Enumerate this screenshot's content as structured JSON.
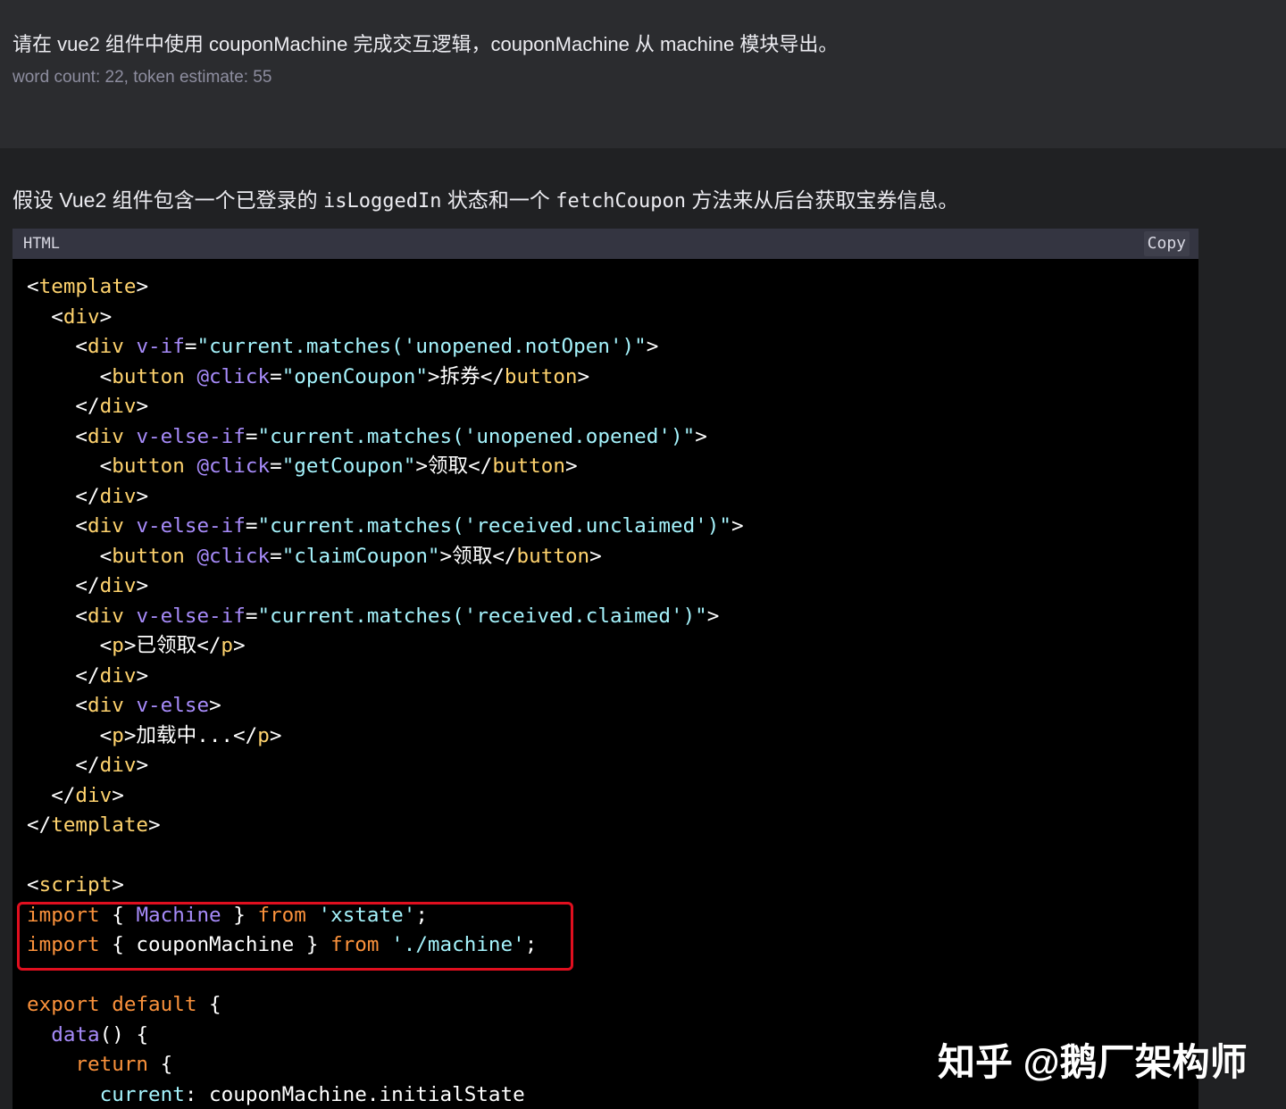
{
  "colors": {
    "tag": "#ffd36e",
    "attr": "#a78bfa",
    "string": "#a5f3fc",
    "keyword": "#fb923c",
    "plain": "#ffffff",
    "highlight": "#e00f1f"
  },
  "user_message": {
    "text": "请在 vue2 组件中使用 couponMachine 完成交互逻辑，couponMachine 从 machine 模块导出。",
    "meta": "word count: 22, token estimate: 55"
  },
  "assistant_message": {
    "intro_before": "假设 Vue2 组件包含一个已登录的 ",
    "code1": "isLoggedIn",
    "intro_mid": " 状态和一个 ",
    "code2": "fetchCoupon",
    "intro_after": " 方法来从后台获取宝券信息。"
  },
  "code_block": {
    "language": "HTML",
    "copy_label": "Copy",
    "lines": [
      [
        [
          "p",
          "<"
        ],
        [
          "t",
          "template"
        ],
        [
          "p",
          ">"
        ]
      ],
      [
        [
          "p",
          "  <"
        ],
        [
          "t",
          "div"
        ],
        [
          "p",
          ">"
        ]
      ],
      [
        [
          "p",
          "    <"
        ],
        [
          "t",
          "div"
        ],
        [
          "p",
          " "
        ],
        [
          "a",
          "v-if"
        ],
        [
          "p",
          "="
        ],
        [
          "s",
          "\"current.matches('unopened.notOpen')\""
        ],
        [
          "p",
          ">"
        ]
      ],
      [
        [
          "p",
          "      <"
        ],
        [
          "t",
          "button"
        ],
        [
          "p",
          " "
        ],
        [
          "a",
          "@click"
        ],
        [
          "p",
          "="
        ],
        [
          "s",
          "\"openCoupon\""
        ],
        [
          "p",
          ">拆券</"
        ],
        [
          "t",
          "button"
        ],
        [
          "p",
          ">"
        ]
      ],
      [
        [
          "p",
          "    </"
        ],
        [
          "t",
          "div"
        ],
        [
          "p",
          ">"
        ]
      ],
      [
        [
          "p",
          "    <"
        ],
        [
          "t",
          "div"
        ],
        [
          "p",
          " "
        ],
        [
          "a",
          "v-else-if"
        ],
        [
          "p",
          "="
        ],
        [
          "s",
          "\"current.matches('unopened.opened')\""
        ],
        [
          "p",
          ">"
        ]
      ],
      [
        [
          "p",
          "      <"
        ],
        [
          "t",
          "button"
        ],
        [
          "p",
          " "
        ],
        [
          "a",
          "@click"
        ],
        [
          "p",
          "="
        ],
        [
          "s",
          "\"getCoupon\""
        ],
        [
          "p",
          ">领取</"
        ],
        [
          "t",
          "button"
        ],
        [
          "p",
          ">"
        ]
      ],
      [
        [
          "p",
          "    </"
        ],
        [
          "t",
          "div"
        ],
        [
          "p",
          ">"
        ]
      ],
      [
        [
          "p",
          "    <"
        ],
        [
          "t",
          "div"
        ],
        [
          "p",
          " "
        ],
        [
          "a",
          "v-else-if"
        ],
        [
          "p",
          "="
        ],
        [
          "s",
          "\"current.matches('received.unclaimed')\""
        ],
        [
          "p",
          ">"
        ]
      ],
      [
        [
          "p",
          "      <"
        ],
        [
          "t",
          "button"
        ],
        [
          "p",
          " "
        ],
        [
          "a",
          "@click"
        ],
        [
          "p",
          "="
        ],
        [
          "s",
          "\"claimCoupon\""
        ],
        [
          "p",
          ">领取</"
        ],
        [
          "t",
          "button"
        ],
        [
          "p",
          ">"
        ]
      ],
      [
        [
          "p",
          "    </"
        ],
        [
          "t",
          "div"
        ],
        [
          "p",
          ">"
        ]
      ],
      [
        [
          "p",
          "    <"
        ],
        [
          "t",
          "div"
        ],
        [
          "p",
          " "
        ],
        [
          "a",
          "v-else-if"
        ],
        [
          "p",
          "="
        ],
        [
          "s",
          "\"current.matches('received.claimed')\""
        ],
        [
          "p",
          ">"
        ]
      ],
      [
        [
          "p",
          "      <"
        ],
        [
          "t",
          "p"
        ],
        [
          "p",
          ">已领取</"
        ],
        [
          "t",
          "p"
        ],
        [
          "p",
          ">"
        ]
      ],
      [
        [
          "p",
          "    </"
        ],
        [
          "t",
          "div"
        ],
        [
          "p",
          ">"
        ]
      ],
      [
        [
          "p",
          "    <"
        ],
        [
          "t",
          "div"
        ],
        [
          "p",
          " "
        ],
        [
          "a",
          "v-else"
        ],
        [
          "p",
          ">"
        ]
      ],
      [
        [
          "p",
          "      <"
        ],
        [
          "t",
          "p"
        ],
        [
          "p",
          ">加载中...</"
        ],
        [
          "t",
          "p"
        ],
        [
          "p",
          ">"
        ]
      ],
      [
        [
          "p",
          "    </"
        ],
        [
          "t",
          "div"
        ],
        [
          "p",
          ">"
        ]
      ],
      [
        [
          "p",
          "  </"
        ],
        [
          "t",
          "div"
        ],
        [
          "p",
          ">"
        ]
      ],
      [
        [
          "p",
          "</"
        ],
        [
          "t",
          "template"
        ],
        [
          "p",
          ">"
        ]
      ],
      [],
      [
        [
          "p",
          "<"
        ],
        [
          "t",
          "script"
        ],
        [
          "p",
          ">"
        ]
      ],
      [
        [
          "k",
          "import"
        ],
        [
          "p",
          " { "
        ],
        [
          "a",
          "Machine"
        ],
        [
          "p",
          " } "
        ],
        [
          "k",
          "from"
        ],
        [
          "p",
          " "
        ],
        [
          "s",
          "'xstate'"
        ],
        [
          "p",
          ";"
        ]
      ],
      [
        [
          "k",
          "import"
        ],
        [
          "p",
          " { couponMachine } "
        ],
        [
          "k",
          "from"
        ],
        [
          "p",
          " "
        ],
        [
          "s",
          "'./machine'"
        ],
        [
          "p",
          ";"
        ]
      ],
      [],
      [
        [
          "k",
          "export"
        ],
        [
          "p",
          " "
        ],
        [
          "k",
          "default"
        ],
        [
          "p",
          " {"
        ]
      ],
      [
        [
          "p",
          "  "
        ],
        [
          "a",
          "data"
        ],
        [
          "p",
          "() {"
        ]
      ],
      [
        [
          "p",
          "    "
        ],
        [
          "k",
          "return"
        ],
        [
          "p",
          " {"
        ]
      ],
      [
        [
          "p",
          "      "
        ],
        [
          "s",
          "current"
        ],
        [
          "p",
          ": couponMachine.initialState"
        ]
      ]
    ]
  },
  "watermark": "知乎 @鹅厂架构师"
}
